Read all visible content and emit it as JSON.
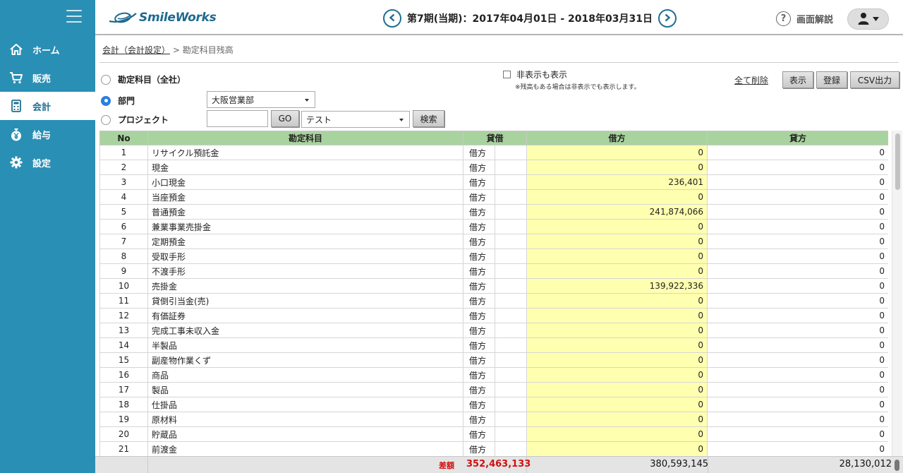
{
  "app": {
    "logo_text": "SmileWorks"
  },
  "colors": {
    "sidebar": "#2a8fb4",
    "header_green": "#a9d39e",
    "debit_bg": "#ffffb0",
    "accent_blue": "#1f6f91",
    "diff_red": "#d01010"
  },
  "sidebar": {
    "items": [
      {
        "label": "ホーム",
        "icon": "home-icon",
        "active": false
      },
      {
        "label": "販売",
        "icon": "cart-icon",
        "active": false
      },
      {
        "label": "会計",
        "icon": "calculator-icon",
        "active": true
      },
      {
        "label": "給与",
        "icon": "yen-bag-icon",
        "active": false
      },
      {
        "label": "設定",
        "icon": "gear-icon",
        "active": false
      }
    ]
  },
  "header": {
    "period": "第7期(当期)：2017年04月01日 - 2018年03月31日",
    "help_label": "画面解説"
  },
  "breadcrumb": {
    "parent": "会計（会計設定）",
    "separator": " > ",
    "current": "勘定科目残高"
  },
  "filters": {
    "options": [
      {
        "label": "勘定科目（全社）",
        "selected": false
      },
      {
        "label": "部門",
        "selected": true
      },
      {
        "label": "プロジェクト",
        "selected": false
      }
    ],
    "department_select": "大阪営業部",
    "project_input": "",
    "go_button": "GO",
    "project_select": "テスト",
    "search_button": "検索",
    "show_hidden": "非表示も表示",
    "show_hidden_note": "※残高もある場合は非表示でも表示します。",
    "delete_all": "全て削除",
    "display_button": "表示",
    "register_button": "登録",
    "csv_button": "CSV出力"
  },
  "table": {
    "headers": [
      "No",
      "勘定科目",
      "貸借",
      "借方",
      "貸方"
    ],
    "rows": [
      {
        "no": "1",
        "account": "リサイクル預託金",
        "dc": "借方",
        "debit": "0",
        "credit": "0"
      },
      {
        "no": "2",
        "account": "現金",
        "dc": "借方",
        "debit": "0",
        "credit": "0"
      },
      {
        "no": "3",
        "account": "小口現金",
        "dc": "借方",
        "debit": "236,401",
        "credit": "0"
      },
      {
        "no": "4",
        "account": "当座預金",
        "dc": "借方",
        "debit": "0",
        "credit": "0"
      },
      {
        "no": "5",
        "account": "普通預金",
        "dc": "借方",
        "debit": "241,874,066",
        "credit": "0"
      },
      {
        "no": "6",
        "account": "兼業事業売掛金",
        "dc": "借方",
        "debit": "0",
        "credit": "0"
      },
      {
        "no": "7",
        "account": "定期預金",
        "dc": "借方",
        "debit": "0",
        "credit": "0"
      },
      {
        "no": "8",
        "account": "受取手形",
        "dc": "借方",
        "debit": "0",
        "credit": "0"
      },
      {
        "no": "9",
        "account": "不渡手形",
        "dc": "借方",
        "debit": "0",
        "credit": "0"
      },
      {
        "no": "10",
        "account": "売掛金",
        "dc": "借方",
        "debit": "139,922,336",
        "credit": "0"
      },
      {
        "no": "11",
        "account": "貸倒引当金(売)",
        "dc": "借方",
        "debit": "0",
        "credit": "0"
      },
      {
        "no": "12",
        "account": "有価証券",
        "dc": "借方",
        "debit": "0",
        "credit": "0"
      },
      {
        "no": "13",
        "account": "完成工事未収入金",
        "dc": "借方",
        "debit": "0",
        "credit": "0"
      },
      {
        "no": "14",
        "account": "半製品",
        "dc": "借方",
        "debit": "0",
        "credit": "0"
      },
      {
        "no": "15",
        "account": "副産物作業くず",
        "dc": "借方",
        "debit": "0",
        "credit": "0"
      },
      {
        "no": "16",
        "account": "商品",
        "dc": "借方",
        "debit": "0",
        "credit": "0"
      },
      {
        "no": "17",
        "account": "製品",
        "dc": "借方",
        "debit": "0",
        "credit": "0"
      },
      {
        "no": "18",
        "account": "仕掛品",
        "dc": "借方",
        "debit": "0",
        "credit": "0"
      },
      {
        "no": "19",
        "account": "原材料",
        "dc": "借方",
        "debit": "0",
        "credit": "0"
      },
      {
        "no": "20",
        "account": "貯蔵品",
        "dc": "借方",
        "debit": "0",
        "credit": "0"
      },
      {
        "no": "21",
        "account": "前渡金",
        "dc": "借方",
        "debit": "0",
        "credit": "0"
      }
    ]
  },
  "totals": {
    "diff_label": "差額",
    "diff_value": "352,463,133",
    "debit_total": "380,593,145",
    "credit_total": "28,130,012"
  }
}
